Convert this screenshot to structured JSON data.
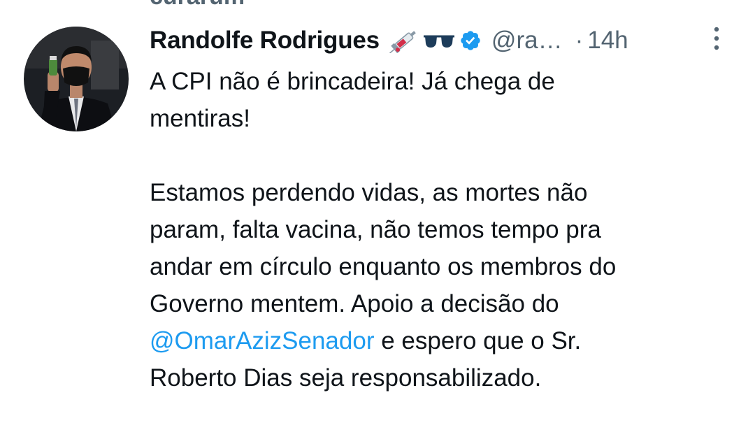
{
  "previous_tweet": {
    "partial_text": "curarum"
  },
  "tweet": {
    "author": {
      "display_name": "Randolfe Rodrigues",
      "handle": "@ra…",
      "verified": true,
      "emojis": [
        "syringe-icon",
        "sunglasses-icon"
      ]
    },
    "dot": "·",
    "time": "14h",
    "text": {
      "para1_line1": "A CPI não é brincadeira! Já chega de",
      "para1_line2": "mentiras!",
      "para2_line1": "Estamos perdendo vidas, as mortes não",
      "para2_line2": "param, falta vacina, não temos tempo pra",
      "para2_line3": "andar em círculo enquanto os membros do",
      "para2_line4": "Governo mentem. Apoio a decisão do",
      "mention": "@OmarAzizSenador",
      "para2_line5_rest": " e espero que o Sr.",
      "para2_line6": "Roberto Dias seja responsabilizado."
    },
    "colors": {
      "mention": "#1d9bf0",
      "secondary": "#536471",
      "verified": "#1d9bf0"
    }
  }
}
